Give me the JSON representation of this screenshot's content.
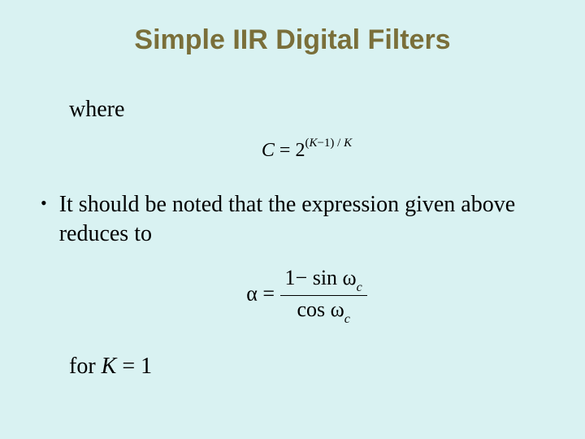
{
  "title": "Simple IIR Digital Filters",
  "where": "where",
  "eq1": {
    "lhs": "C",
    "equals": " = ",
    "base": "2",
    "exp_open": "(",
    "exp_k": "K",
    "exp_minus": "−1)",
    "exp_slash": " / ",
    "exp_k2": "K"
  },
  "bullet": {
    "marker": "•",
    "text": "It should be noted that the expression given above reduces to"
  },
  "eq2": {
    "alpha": "α",
    "equals": " = ",
    "num_pre": "1− sin ω",
    "num_sub": "c",
    "den_pre": "cos ω",
    "den_sub": "c"
  },
  "for": {
    "pre": "for ",
    "k": "K",
    "post": " = 1"
  }
}
